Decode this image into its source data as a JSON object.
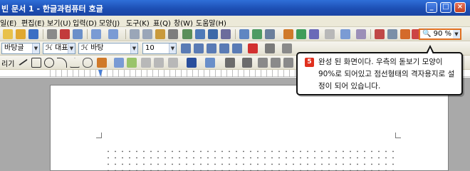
{
  "window": {
    "title": "빈 문서 1 - 한글과컴퓨터 호글",
    "minimize": "_",
    "maximize": "□",
    "close": "×"
  },
  "menu": [
    "일(E)",
    "편집(E)",
    "보기(U)",
    "입력(D)",
    "모양(J)",
    "도구(K)",
    "표(Q)",
    "창(W)",
    "도움말(H)"
  ],
  "toolbar": {
    "style_combo": "바탕글",
    "font_type_combo": "대표",
    "font_combo": "바탕",
    "size_combo": "10",
    "zoom_value": "90 %"
  },
  "toolbar3_label": "리기",
  "callout": {
    "number": "5",
    "text": "완성 된 화면이다. 우측의 돋보기 모양이 90%로 되어있고 점선형태의 격자용지로 설정이 되어 있습니다."
  },
  "colors": {
    "titlebar": "#1d4fb4",
    "zoom_highlight": "#e07020",
    "callout_badge": "#e0301e"
  }
}
